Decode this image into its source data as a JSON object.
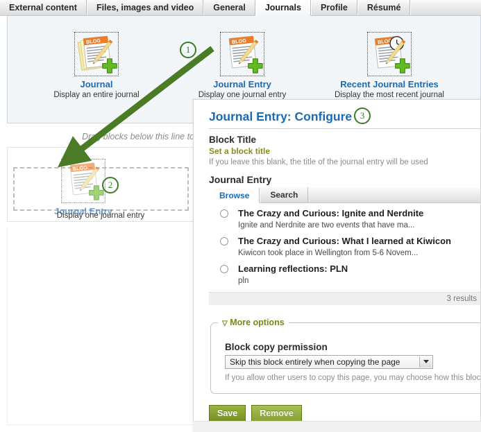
{
  "tabs": [
    {
      "label": "External content",
      "active": false
    },
    {
      "label": "Files, images and video",
      "active": false
    },
    {
      "label": "General",
      "active": false
    },
    {
      "label": "Journals",
      "active": true
    },
    {
      "label": "Profile",
      "active": false
    },
    {
      "label": "Résumé",
      "active": false
    }
  ],
  "palette": {
    "blocks": [
      {
        "title": "Journal",
        "desc": "Display an entire journal",
        "icon": "journal-icon"
      },
      {
        "title": "Journal Entry",
        "desc": "Display one journal entry",
        "icon": "journal-entry-icon"
      },
      {
        "title": "Recent Journal Entries",
        "desc": "Display the most recent journal entries",
        "icon": "recent-journal-entries-icon"
      }
    ]
  },
  "callouts": [
    {
      "number": "1"
    },
    {
      "number": "2"
    },
    {
      "number": "3"
    }
  ],
  "canvas": {
    "drag_hint": "Drag blocks below this line to",
    "dragged_block": {
      "title": "Journal Entry",
      "desc": "Display one journal entry"
    }
  },
  "configure": {
    "title": "Journal Entry: Configure",
    "block_title_label": "Block Title",
    "block_title_link": "Set a block title",
    "block_title_help": "If you leave this blank, the title of the journal entry will be used",
    "section_label": "Journal Entry",
    "tabs": [
      {
        "label": "Browse",
        "active": true
      },
      {
        "label": "Search",
        "active": false
      }
    ],
    "results": [
      {
        "title": "The Crazy and Curious: Ignite and Nerdnite",
        "desc": "Ignite and Nerdnite are two events that have ma...",
        "selected": false
      },
      {
        "title": "The Crazy and Curious: What I learned at Kiwicon",
        "desc": "Kiwicon took place in Wellington from 5-6 Novem...",
        "selected": false
      },
      {
        "title": "Learning reflections: PLN",
        "desc": "pln",
        "selected": false
      }
    ],
    "results_count": "3 results",
    "more_options_legend": "More options",
    "more_options_caret": "▽",
    "block_copy_permission_label": "Block copy permission",
    "block_copy_permission_value": "Skip this block entirely when copying the page",
    "block_copy_permission_options": [
      "Skip this block entirely when copying the page"
    ],
    "block_copy_permission_help": "If you allow other users to copy this page, you may choose how this block will",
    "save_label": "Save",
    "remove_label": "Remove"
  },
  "colors": {
    "link_blue": "#1a6bb5",
    "accent_green": "#3c7a29",
    "arrow_green": "#4a7c26",
    "olive": "#8a8a1f",
    "button_green": "#84a02f",
    "panel_blue_bg": "#f2f6f9"
  }
}
